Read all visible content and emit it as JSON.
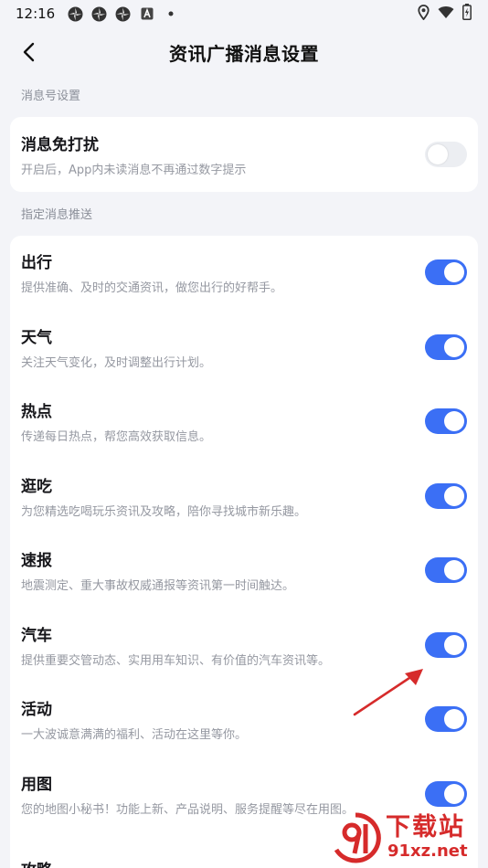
{
  "status_bar": {
    "time": "12:16",
    "icons_left": [
      "pinwheel-icon",
      "pinwheel-icon",
      "pinwheel-icon",
      "a-badge-icon",
      "dot-icon"
    ],
    "icons_right": [
      "location-icon",
      "wifi-icon",
      "battery-icon"
    ]
  },
  "header": {
    "title": "资讯广播消息设置"
  },
  "section1": {
    "label": "消息号设置",
    "items": [
      {
        "title": "消息免打扰",
        "desc": "开启后，App内未读消息不再通过数字提示",
        "enabled": false
      }
    ]
  },
  "section2": {
    "label": "指定消息推送",
    "items": [
      {
        "title": "出行",
        "desc": "提供准确、及时的交通资讯，做您出行的好帮手。",
        "enabled": true
      },
      {
        "title": "天气",
        "desc": "关注天气变化，及时调整出行计划。",
        "enabled": true
      },
      {
        "title": "热点",
        "desc": "传递每日热点，帮您高效获取信息。",
        "enabled": true
      },
      {
        "title": "逛吃",
        "desc": "为您精选吃喝玩乐资讯及攻略，陪你寻找城市新乐趣。",
        "enabled": true
      },
      {
        "title": "速报",
        "desc": "地震测定、重大事故权威通报等资讯第一时间触达。",
        "enabled": true
      },
      {
        "title": "汽车",
        "desc": "提供重要交管动态、实用用车知识、有价值的汽车资讯等。",
        "enabled": true
      },
      {
        "title": "活动",
        "desc": "一大波诚意满满的福利、活动在这里等你。",
        "enabled": true
      },
      {
        "title": "用图",
        "desc": "您的地图小秘书！功能上新、产品说明、服务提醒等尽在用图。",
        "enabled": true
      },
      {
        "title": "攻略",
        "desc": "",
        "enabled": true
      }
    ]
  },
  "watermark": {
    "line1": "下载站",
    "line2": "91xz.net"
  },
  "colors": {
    "accent": "#3b6ff5",
    "background": "#f3f4f8",
    "annotation": "#d62b2b"
  }
}
